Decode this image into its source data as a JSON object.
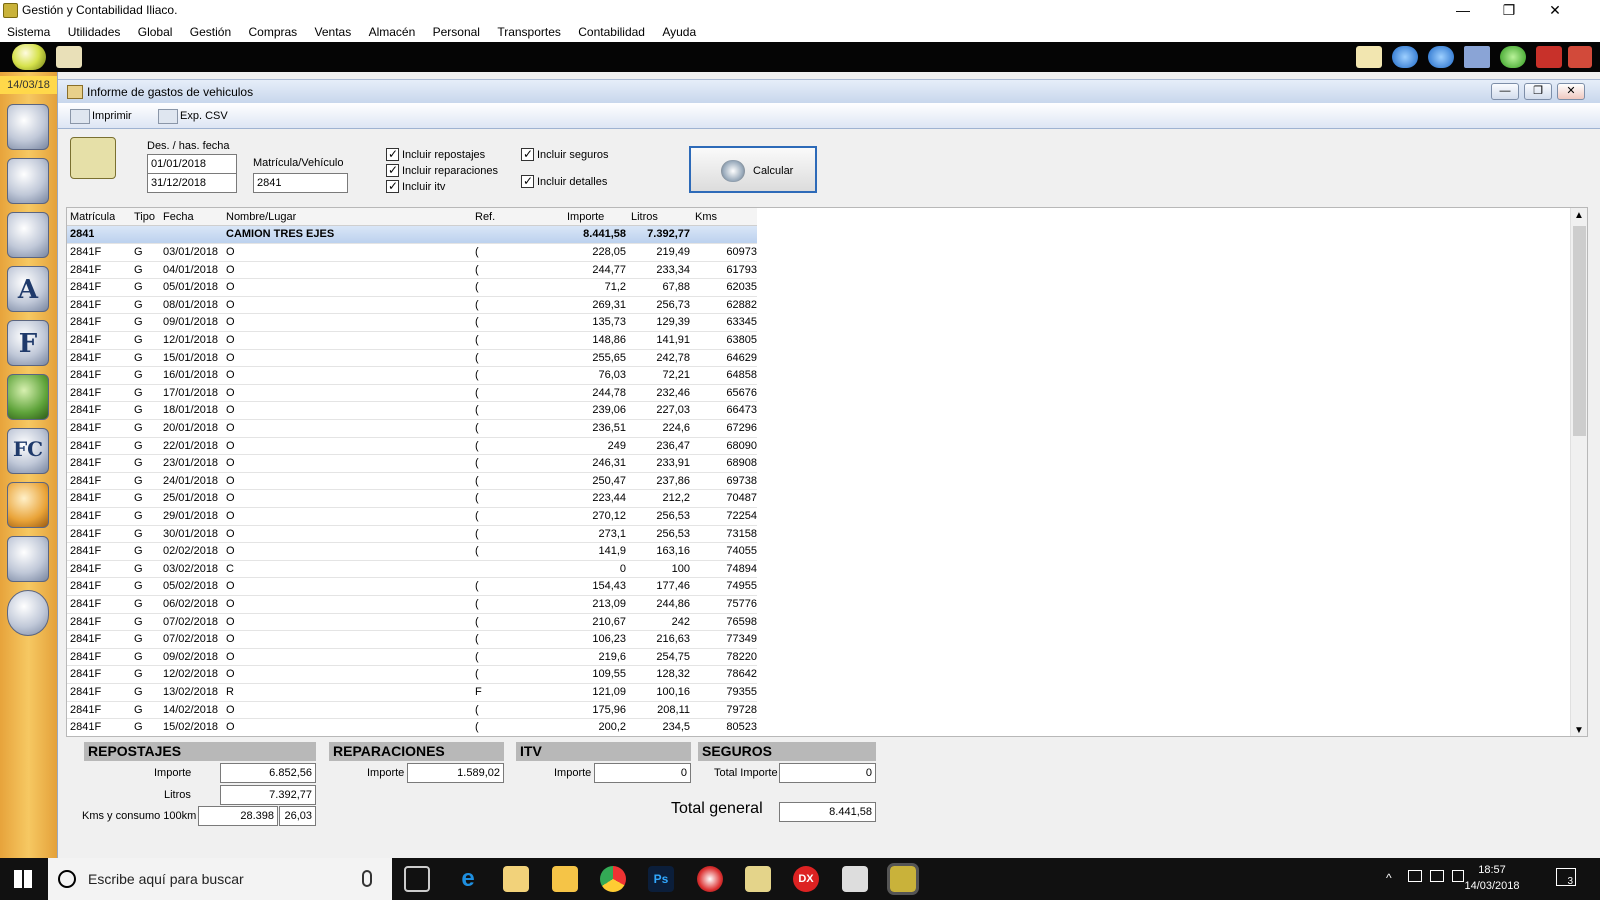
{
  "app": {
    "title": "Gestión y Contabilidad Iliaco."
  },
  "window_controls": {
    "minimize": "—",
    "restore": "❐",
    "close": "✕"
  },
  "menu": [
    "Sistema",
    "Utilidades",
    "Global",
    "Gestión",
    "Compras",
    "Ventas",
    "Almacén",
    "Personal",
    "Transportes",
    "Contabilidad",
    "Ayuda"
  ],
  "sidebar": {
    "date": "14/03/18"
  },
  "report": {
    "title": "Informe de gastos de vehiculos",
    "tools": {
      "print": "Imprimir",
      "csv": "Exp. CSV"
    },
    "params": {
      "date_label": "Des. / has. fecha",
      "date_from": "01/01/2018",
      "date_to": "31/12/2018",
      "vehicle_label": "Matrícula/Vehículo",
      "vehicle": "2841",
      "chk_repostajes": "Incluir repostajes",
      "chk_reparaciones": "Incluir reparaciones",
      "chk_itv": "Incluir itv",
      "chk_seguros": "Incluir seguros",
      "chk_detalles": "Incluir detalles",
      "calc": "Calcular"
    },
    "columns": {
      "matricula": "Matrícula",
      "tipo": "Tipo",
      "fecha": "Fecha",
      "nombre": "Nombre/Lugar",
      "ref": "Ref.",
      "importe": "Importe",
      "litros": "Litros",
      "kms": "Kms"
    },
    "group": {
      "matricula": "2841",
      "nombre": "CAMION TRES EJES",
      "importe": "8.441,58",
      "litros": "7.392,77"
    },
    "rows": [
      [
        "2841F",
        "G",
        "03/01/2018",
        "O",
        "(",
        "228,05",
        "219,49",
        "60973"
      ],
      [
        "2841F",
        "G",
        "04/01/2018",
        "O",
        "(",
        "244,77",
        "233,34",
        "61793"
      ],
      [
        "2841F",
        "G",
        "05/01/2018",
        "O",
        "(",
        "71,2",
        "67,88",
        "62035"
      ],
      [
        "2841F",
        "G",
        "08/01/2018",
        "O",
        "(",
        "269,31",
        "256,73",
        "62882"
      ],
      [
        "2841F",
        "G",
        "09/01/2018",
        "O",
        "(",
        "135,73",
        "129,39",
        "63345"
      ],
      [
        "2841F",
        "G",
        "12/01/2018",
        "O",
        "(",
        "148,86",
        "141,91",
        "63805"
      ],
      [
        "2841F",
        "G",
        "15/01/2018",
        "O",
        "(",
        "255,65",
        "242,78",
        "64629"
      ],
      [
        "2841F",
        "G",
        "16/01/2018",
        "O",
        "(",
        "76,03",
        "72,21",
        "64858"
      ],
      [
        "2841F",
        "G",
        "17/01/2018",
        "O",
        "(",
        "244,78",
        "232,46",
        "65676"
      ],
      [
        "2841F",
        "G",
        "18/01/2018",
        "O",
        "(",
        "239,06",
        "227,03",
        "66473"
      ],
      [
        "2841F",
        "G",
        "20/01/2018",
        "O",
        "(",
        "236,51",
        "224,6",
        "67296"
      ],
      [
        "2841F",
        "G",
        "22/01/2018",
        "O",
        "(",
        "249",
        "236,47",
        "68090"
      ],
      [
        "2841F",
        "G",
        "23/01/2018",
        "O",
        "(",
        "246,31",
        "233,91",
        "68908"
      ],
      [
        "2841F",
        "G",
        "24/01/2018",
        "O",
        "(",
        "250,47",
        "237,86",
        "69738"
      ],
      [
        "2841F",
        "G",
        "25/01/2018",
        "O",
        "(",
        "223,44",
        "212,2",
        "70487"
      ],
      [
        "2841F",
        "G",
        "29/01/2018",
        "O",
        "(",
        "270,12",
        "256,53",
        "72254"
      ],
      [
        "2841F",
        "G",
        "30/01/2018",
        "O",
        "(",
        "273,1",
        "256,53",
        "73158"
      ],
      [
        "2841F",
        "G",
        "02/02/2018",
        "O",
        "(",
        "141,9",
        "163,16",
        "74055"
      ],
      [
        "2841F",
        "G",
        "03/02/2018",
        "C",
        "",
        "0",
        "100",
        "74894"
      ],
      [
        "2841F",
        "G",
        "05/02/2018",
        "O",
        "(",
        "154,43",
        "177,46",
        "74955"
      ],
      [
        "2841F",
        "G",
        "06/02/2018",
        "O",
        "(",
        "213,09",
        "244,86",
        "75776"
      ],
      [
        "2841F",
        "G",
        "07/02/2018",
        "O",
        "(",
        "210,67",
        "242",
        "76598"
      ],
      [
        "2841F",
        "G",
        "07/02/2018",
        "O",
        "(",
        "106,23",
        "216,63",
        "77349"
      ],
      [
        "2841F",
        "G",
        "09/02/2018",
        "O",
        "(",
        "219,6",
        "254,75",
        "78220"
      ],
      [
        "2841F",
        "G",
        "12/02/2018",
        "O",
        "(",
        "109,55",
        "128,32",
        "78642"
      ],
      [
        "2841F",
        "G",
        "13/02/2018",
        "R",
        "F",
        "121,09",
        "100,16",
        "79355"
      ],
      [
        "2841F",
        "G",
        "14/02/2018",
        "O",
        "(",
        "175,96",
        "208,11",
        "79728"
      ],
      [
        "2841F",
        "G",
        "15/02/2018",
        "O",
        "(",
        "200,2",
        "234,5",
        "80523"
      ]
    ],
    "summary": {
      "repostajes": {
        "title": "REPOSTAJES",
        "importe_label": "Importe",
        "importe": "6.852,56",
        "litros_label": "Litros",
        "litros": "7.392,77",
        "kms_label": "Kms y consumo 100km",
        "kms": "28.398",
        "consumo": "26,03"
      },
      "reparaciones": {
        "title": "REPARACIONES",
        "importe_label": "Importe",
        "importe": "1.589,02"
      },
      "itv": {
        "title": "ITV",
        "importe_label": "Importe",
        "importe": "0"
      },
      "seguros": {
        "title": "SEGUROS",
        "importe_label": "Total Importe",
        "importe": "0"
      },
      "total_label": "Total general",
      "total": "8.441,58"
    }
  },
  "taskbar": {
    "search_placeholder": "Escribe aquí para buscar",
    "time": "18:57",
    "date": "14/03/2018",
    "notif_count": "3",
    "dx": "DX",
    "ps": "Ps"
  },
  "colors": {
    "accent": "#2d6ab8",
    "sidebar": "#f3be55",
    "group_row": "#c7d9f1"
  }
}
